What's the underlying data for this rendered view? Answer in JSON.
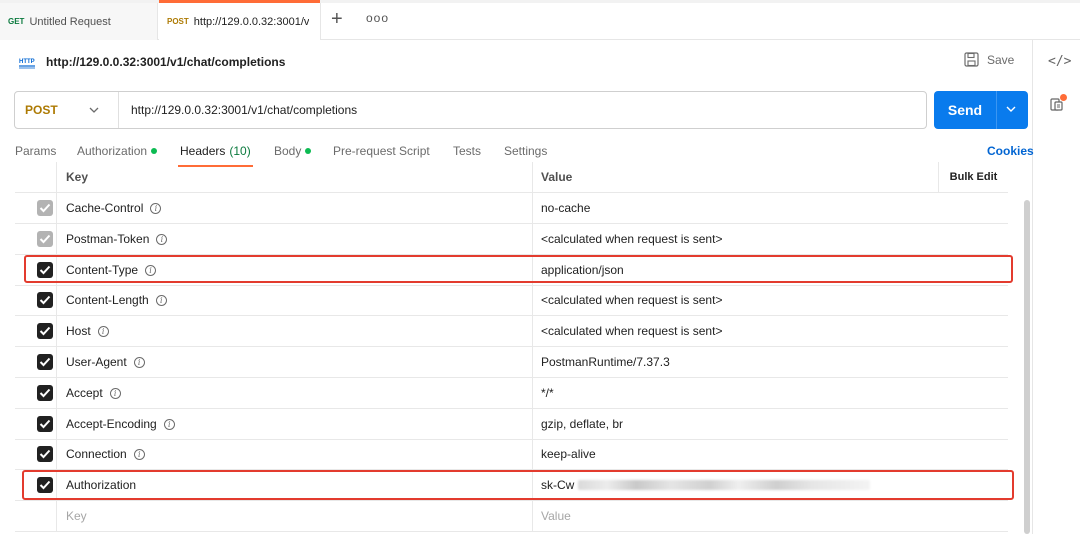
{
  "tabs": [
    {
      "method": "GET",
      "title": "Untitled Request"
    },
    {
      "method": "POST",
      "title": "http://129.0.0.32:3001/v"
    }
  ],
  "tabbar": {
    "new_tab": "+",
    "more": "ooo"
  },
  "request": {
    "icon_label": "HTTP",
    "title": "http://129.0.0.32:3001/v1/chat/completions",
    "save_label": "Save",
    "method": "POST",
    "url": "http://129.0.0.32:3001/v1/chat/completions",
    "send_label": "Send"
  },
  "request_tabs": [
    {
      "label": "Params"
    },
    {
      "label": "Authorization",
      "dot": true
    },
    {
      "label": "Headers",
      "count": "(10)",
      "active": true
    },
    {
      "label": "Body",
      "dot": true
    },
    {
      "label": "Pre-request Script"
    },
    {
      "label": "Tests"
    },
    {
      "label": "Settings"
    }
  ],
  "cookies_label": "Cookies",
  "headers_table": {
    "columns": {
      "key": "Key",
      "value": "Value",
      "bulk": "Bulk Edit"
    },
    "rows": [
      {
        "key": "Cache-Control",
        "value": "no-cache",
        "checked": "grey",
        "info": true
      },
      {
        "key": "Postman-Token",
        "value": "<calculated when request is sent>",
        "checked": "grey",
        "info": true
      },
      {
        "key": "Content-Type",
        "value": "application/json",
        "checked": "on",
        "info": true
      },
      {
        "key": "Content-Length",
        "value": "<calculated when request is sent>",
        "checked": "on",
        "info": true
      },
      {
        "key": "Host",
        "value": "<calculated when request is sent>",
        "checked": "on",
        "info": true
      },
      {
        "key": "User-Agent",
        "value": "PostmanRuntime/7.37.3",
        "checked": "on",
        "info": true
      },
      {
        "key": "Accept",
        "value": "*/*",
        "checked": "on",
        "info": true
      },
      {
        "key": "Accept-Encoding",
        "value": "gzip, deflate, br",
        "checked": "on",
        "info": true
      },
      {
        "key": "Connection",
        "value": "keep-alive",
        "checked": "on",
        "info": true
      },
      {
        "key": "Authorization",
        "value": "sk-Cw",
        "checked": "on",
        "info": false
      }
    ],
    "placeholder": {
      "key": "Key",
      "value": "Value"
    }
  },
  "colors": {
    "accent": "#ff6c37",
    "send": "#097bed",
    "post": "#ad7a03",
    "highlight": "#e33b2e"
  }
}
